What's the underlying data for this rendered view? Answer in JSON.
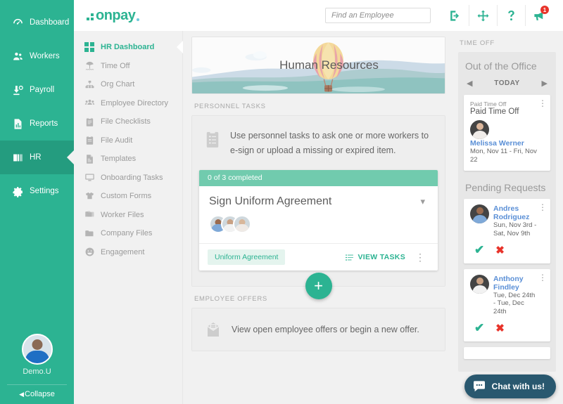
{
  "main_nav": {
    "items": [
      {
        "label": "Dashboard",
        "icon": "gauge-icon",
        "active": false
      },
      {
        "label": "Workers",
        "icon": "people-icon",
        "active": false
      },
      {
        "label": "Payroll",
        "icon": "money-icon",
        "active": false
      },
      {
        "label": "Reports",
        "icon": "report-icon",
        "active": false
      },
      {
        "label": "HR",
        "icon": "book-icon",
        "active": true
      },
      {
        "label": "Settings",
        "icon": "gear-icon",
        "active": false
      }
    ],
    "user_name": "Demo.U",
    "collapse_label": "Collapse"
  },
  "topbar": {
    "logo_text": "onpay",
    "search_placeholder": "Find an Employee",
    "search_value": "",
    "icons": [
      {
        "name": "logout-icon",
        "badge": ""
      },
      {
        "name": "move-icon",
        "badge": ""
      },
      {
        "name": "help-icon",
        "badge": ""
      },
      {
        "name": "announcement-icon",
        "badge": "1"
      }
    ]
  },
  "subnav": {
    "items": [
      {
        "label": "HR Dashboard",
        "icon": "grid-icon",
        "active": true
      },
      {
        "label": "Time Off",
        "icon": "beach-icon",
        "active": false
      },
      {
        "label": "Org Chart",
        "icon": "hierarchy-icon",
        "active": false
      },
      {
        "label": "Employee Directory",
        "icon": "users-icon",
        "active": false
      },
      {
        "label": "File Checklists",
        "icon": "clipboard-check-icon",
        "active": false
      },
      {
        "label": "File Audit",
        "icon": "clipboard-icon",
        "active": false
      },
      {
        "label": "Templates",
        "icon": "document-icon",
        "active": false
      },
      {
        "label": "Onboarding Tasks",
        "icon": "monitor-icon",
        "active": false
      },
      {
        "label": "Custom Forms",
        "icon": "shirt-icon",
        "active": false
      },
      {
        "label": "Worker Files",
        "icon": "folders-icon",
        "active": false
      },
      {
        "label": "Company Files",
        "icon": "folder-icon",
        "active": false
      },
      {
        "label": "Engagement",
        "icon": "smiley-icon",
        "active": false
      }
    ]
  },
  "hero": {
    "title": "Human Resources"
  },
  "personnel": {
    "section_label": "PERSONNEL TASKS",
    "description": "Use personnel tasks to ask one or more workers to e-sign or upload a missing or expired item.",
    "task": {
      "progress_label": "0 of 3 completed",
      "title": "Sign Uniform Agreement",
      "chip_label": "Uniform Agreement",
      "view_tasks_label": "VIEW TASKS",
      "assignees": [
        {
          "name": "assignee-1",
          "skin": "#9a6b4f",
          "shirt": "#7fa9d8"
        },
        {
          "name": "assignee-2",
          "skin": "#c9a184",
          "shirt": "#f2f2f2"
        },
        {
          "name": "assignee-3",
          "skin": "#d8b79b",
          "shirt": "#efeae6"
        }
      ]
    },
    "add_label": "+"
  },
  "offers": {
    "section_label": "EMPLOYEE OFFERS",
    "description": "View open employee offers or begin a new offer."
  },
  "time_off": {
    "section_label": "TIME OFF",
    "out_of_office_title": "Out of the Office",
    "today_label": "TODAY",
    "prev_label": "◀",
    "next_label": "▶",
    "out_cards": [
      {
        "sub": "Paid Time Off",
        "main": "Paid Time Off",
        "person": "Melissa Werner",
        "dates": "Mon, Nov 11 - Fri, Nov 22",
        "skin": "#dcb79c",
        "shirt": "#f0ece9"
      }
    ],
    "pending_title": "Pending Requests",
    "pending": [
      {
        "person": "Andres Rodriguez",
        "dates": "Sun, Nov 3rd - Sat, Nov 9th",
        "skin": "#9a6b4f",
        "shirt": "#7fa9d8",
        "approve": "✔",
        "deny": "✖"
      },
      {
        "person": "Anthony Findley",
        "dates": "Tue, Dec 24th - Tue, Dec 24th",
        "skin": "#c9a184",
        "shirt": "#f2f2f2",
        "approve": "✔",
        "deny": "✖"
      },
      {
        "person": "",
        "dates": "",
        "skin": "#c9a184",
        "shirt": "#f2f2f2",
        "approve": "",
        "deny": ""
      }
    ]
  },
  "chat": {
    "label": "Chat with us!"
  },
  "colors": {
    "brand_green": "#2cb392",
    "brand_green_dark": "#249c7f",
    "task_bar_green": "#71cbae",
    "link_blue": "#5a8fd6",
    "danger_red": "#e8332a",
    "chat_navy": "#29586f",
    "page_bg": "#f1f1f1"
  }
}
